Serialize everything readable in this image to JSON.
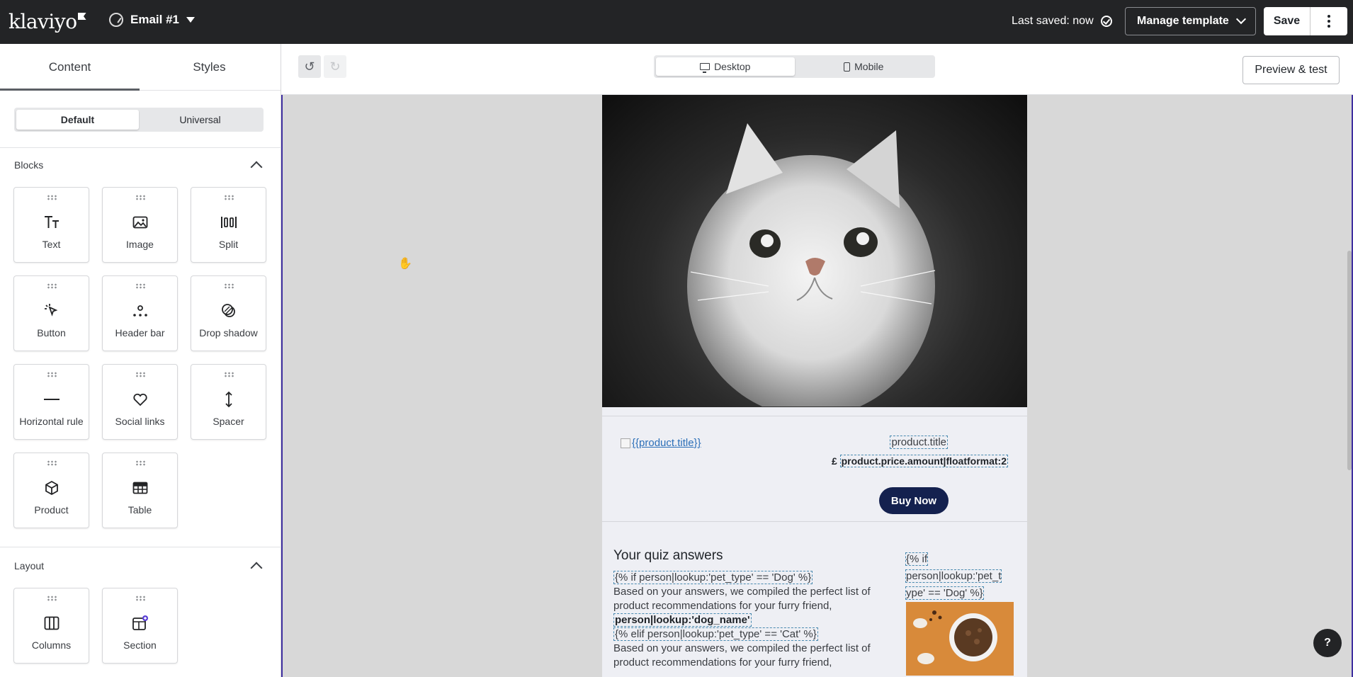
{
  "topbar": {
    "logo": "klaviyo",
    "email_name": "Email #1",
    "last_saved": "Last saved: now",
    "manage_template": "Manage template",
    "save": "Save"
  },
  "left_panel": {
    "tabs": [
      "Content",
      "Styles"
    ],
    "active_tab": "Content",
    "mode": [
      "Default",
      "Universal"
    ],
    "blocks_title": "Blocks",
    "blocks": [
      {
        "label": "Text",
        "icon": "text-icon"
      },
      {
        "label": "Image",
        "icon": "image-icon"
      },
      {
        "label": "Split",
        "icon": "split-icon"
      },
      {
        "label": "Button",
        "icon": "button-icon"
      },
      {
        "label": "Header bar",
        "icon": "header-bar-icon"
      },
      {
        "label": "Drop shadow",
        "icon": "drop-shadow-icon"
      },
      {
        "label": "Horizontal rule",
        "icon": "horizontal-rule-icon"
      },
      {
        "label": "Social links",
        "icon": "heart-icon"
      },
      {
        "label": "Spacer",
        "icon": "spacer-icon"
      },
      {
        "label": "Product",
        "icon": "cube-icon"
      },
      {
        "label": "Table",
        "icon": "table-icon"
      }
    ],
    "layout_title": "Layout",
    "layout": [
      {
        "label": "Columns",
        "icon": "columns-icon"
      },
      {
        "label": "Section",
        "icon": "section-icon"
      }
    ]
  },
  "toolbar": {
    "device": [
      "Desktop",
      "Mobile"
    ],
    "active_device": "Desktop",
    "preview": "Preview & test"
  },
  "email": {
    "product_image_alt": "{{product.title}}",
    "product_title": "product.title",
    "price_prefix": "£",
    "price_tag": "product.price.amount|floatformat:2",
    "buy_button": "Buy Now",
    "quiz_heading": "Your quiz answers",
    "quiz_if": "{% if person|lookup:'pet_type' == 'Dog' %}",
    "quiz_body_1": "Based on your answers, we compiled the perfect list of product recommendations for your furry friend,",
    "quiz_dog_name": "person|lookup:'dog_name'",
    "quiz_elif": "{% elif person|lookup:'pet_type' == 'Cat' %}",
    "quiz_body_2": "Based on your answers, we compiled the perfect list of product recommendations for your furry friend,",
    "side_if_1": "{% if",
    "side_if_2": "person|lookup:'pet_t",
    "side_if_3": "ype' == 'Dog' %}"
  },
  "help": "?"
}
